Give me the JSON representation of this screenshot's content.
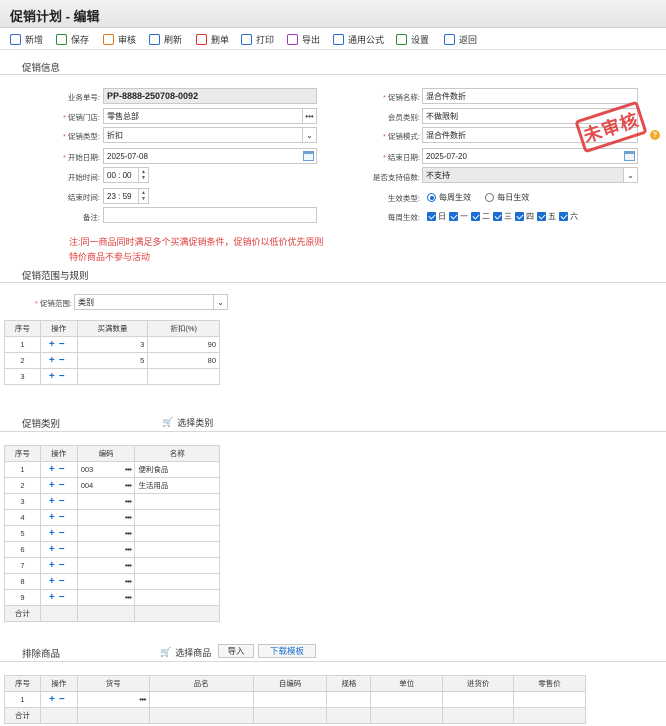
{
  "window": {
    "title": "促销计划 - 编辑"
  },
  "toolbar": [
    {
      "label": "新增",
      "icon": "new-doc-icon",
      "color": "#2a6fd0"
    },
    {
      "label": "保存",
      "icon": "save-icon",
      "color": "#2e8b3a"
    },
    {
      "label": "审核",
      "icon": "approve-icon",
      "color": "#e07a1b"
    },
    {
      "label": "刷新",
      "icon": "refresh-icon",
      "color": "#2a6fd0"
    },
    {
      "label": "删单",
      "icon": "delete-doc-icon",
      "color": "#d9332b"
    },
    {
      "label": "打印",
      "icon": "print-icon",
      "color": "#2a6fd0"
    },
    {
      "label": "导出",
      "icon": "export-icon",
      "color": "#9b3fc0"
    },
    {
      "label": "通用公式",
      "icon": "formula-icon",
      "color": "#2a6fd0"
    },
    {
      "label": "设置",
      "icon": "settings-icon",
      "color": "#2e8b3a"
    },
    {
      "label": "返回",
      "icon": "back-icon",
      "color": "#2a6fd0"
    }
  ],
  "promo_info": {
    "section_title": "促销信息",
    "doc_no_label": "业务单号:",
    "doc_no": "PP-8888-250708-0092",
    "store_label": "促销门店:",
    "store": "零售总部",
    "type_label": "促销类型:",
    "type": "折扣",
    "start_date_label": "开始日期:",
    "start_date": "2025-07-08",
    "start_time_label": "开始时间:",
    "start_time": "00 : 00",
    "end_time_label": "结束时间:",
    "end_time": "23 : 59",
    "remark_label": "备注:",
    "remark": "",
    "name_label": "促销名称:",
    "name": "混合件数折",
    "member_label": "会员类别:",
    "member": "不做限制",
    "mode_label": "促销模式:",
    "mode": "混合件数折",
    "end_date_label": "结束日期:",
    "end_date": "2025-07-20",
    "multiple_label": "是否支持倍数:",
    "multiple": "不支持",
    "effect_type_label": "生效类型:",
    "effect_options": [
      "每周生效",
      "每日生效"
    ],
    "weekly_label": "每周生效:",
    "weekdays": [
      "日",
      "一",
      "二",
      "三",
      "四",
      "五",
      "六"
    ],
    "stamp": "未审核",
    "help": "?",
    "note_line1": "注:同一商品同时满足多个买满促销条件，促销价以低价优先原则",
    "note_line2": "特价商品不参与活动"
  },
  "scope": {
    "section_title": "促销范围与规则",
    "scope_label": "促销范围:",
    "scope_value": "类别",
    "headers": [
      "序号",
      "操作",
      "买满数量",
      "折扣(%)"
    ],
    "rows": [
      {
        "no": "1",
        "qty": "3",
        "discount": "90"
      },
      {
        "no": "2",
        "qty": "5",
        "discount": "80"
      },
      {
        "no": "3",
        "qty": "",
        "discount": ""
      }
    ]
  },
  "category": {
    "section_title": "促销类别",
    "select_label": "选择类别",
    "headers": [
      "序号",
      "操作",
      "编码",
      "名称"
    ],
    "rows": [
      {
        "no": "1",
        "code": "003",
        "name": "便利食品"
      },
      {
        "no": "2",
        "code": "004",
        "name": "生活用品"
      },
      {
        "no": "3",
        "code": "",
        "name": ""
      },
      {
        "no": "4",
        "code": "",
        "name": ""
      },
      {
        "no": "5",
        "code": "",
        "name": ""
      },
      {
        "no": "6",
        "code": "",
        "name": ""
      },
      {
        "no": "7",
        "code": "",
        "name": ""
      },
      {
        "no": "8",
        "code": "",
        "name": ""
      },
      {
        "no": "9",
        "code": "",
        "name": ""
      }
    ],
    "total_label": "合计"
  },
  "exclude": {
    "section_title": "排除商品",
    "select_label": "选择商品",
    "import_label": "导入",
    "template_label": "下载模板",
    "headers": [
      "序号",
      "操作",
      "货号",
      "品名",
      "自编码",
      "规格",
      "单位",
      "进货价",
      "零售价"
    ],
    "rows": [
      {
        "no": "1"
      }
    ],
    "total_label": "合计"
  },
  "symbols": {
    "plus": "+",
    "minus": "−",
    "dots": "•••",
    "caret": "⌄"
  }
}
